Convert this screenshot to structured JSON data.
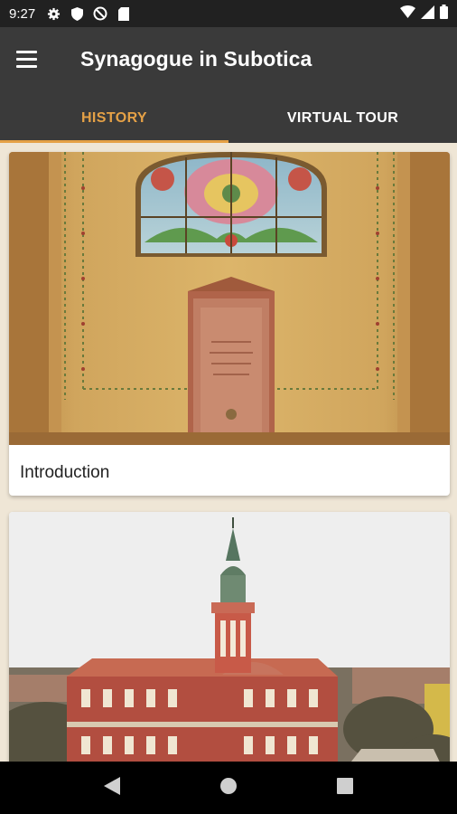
{
  "status_bar": {
    "time": "9:27",
    "left_icons": [
      "gear-icon",
      "shield-icon",
      "data-saver-icon",
      "sd-card-icon"
    ],
    "right_icons": [
      "wifi-icon",
      "signal-icon",
      "battery-icon"
    ]
  },
  "app_bar": {
    "title": "Synagogue in Subotica",
    "menu_icon": "hamburger-menu-icon"
  },
  "tabs": [
    {
      "label": "HISTORY",
      "active": true
    },
    {
      "label": "VIRTUAL TOUR",
      "active": false
    }
  ],
  "cards": [
    {
      "caption": "Introduction",
      "image": "synagogue interior with stained glass window and memorial plaque"
    },
    {
      "caption": "",
      "image": "aerial view of Subotica city hall with tower"
    }
  ],
  "nav_bar": {
    "icons": [
      "back-icon",
      "home-icon",
      "recents-icon"
    ]
  },
  "colors": {
    "accent": "#e5a146",
    "app_bar": "#3a3a3a",
    "status_bar": "#212121",
    "background": "#efe6d6"
  }
}
